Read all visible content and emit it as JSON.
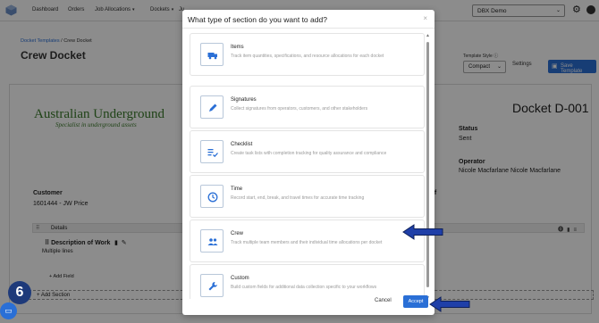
{
  "nav": {
    "items": [
      "Dashboard",
      "Orders",
      "Job Allocations",
      "Dockets",
      "Ju"
    ],
    "org": "DBX Demo"
  },
  "breadcrumb": {
    "parent": "Docket Templates",
    "sep": "/",
    "current": "Crew Docket"
  },
  "page_title": "Crew Docket",
  "toolbar": {
    "template_style_label": "Template Style",
    "template_style_value": "Compact",
    "settings_label": "Settings",
    "save_label": "Save Template"
  },
  "docket": {
    "brand_name": "Australian Underground",
    "brand_tagline": "Specialist in underground assets",
    "number": "Docket D-001",
    "status_label": "Status",
    "status_value": "Sent",
    "operator_label": "Operator",
    "operator_value": "Nicole Macfarlane Nicole Macfarlane",
    "customer_label": "Customer",
    "customer_value": "1601444 - JW Price",
    "ref_label": "ef",
    "details_label": "Details",
    "description_label": "Description of Work",
    "description_sub": "Multiple lines",
    "add_field": "Add Field",
    "add_section": "+ Add Section"
  },
  "step_number": "6",
  "modal": {
    "title": "What type of section do you want to add?",
    "close": "×",
    "options": [
      {
        "title": "Items",
        "desc": "Track item quantities, specifications, and resource allocations for each docket",
        "icon": "truck-icon"
      },
      {
        "title": "Signatures",
        "desc": "Collect signatures from operators, customers, and other stakeholders",
        "icon": "pen-icon"
      },
      {
        "title": "Checklist",
        "desc": "Create task lists with completion tracking for quality assurance and compliance",
        "icon": "checklist-icon"
      },
      {
        "title": "Time",
        "desc": "Record start, end, break, and travel times for accurate time tracking",
        "icon": "clock-icon"
      },
      {
        "title": "Crew",
        "desc": "Track multiple team members and their individual time allocations per docket",
        "icon": "people-icon"
      },
      {
        "title": "Custom",
        "desc": "Build custom fields for additional data collection specific to your workflows",
        "icon": "wrench-icon"
      }
    ],
    "cancel_label": "Cancel",
    "accept_label": "Accept"
  },
  "colors": {
    "primary": "#2a6fd6",
    "badge": "#1e3a7a",
    "arrow": "#1f3fa8",
    "brand_green": "#3a7a2a"
  }
}
